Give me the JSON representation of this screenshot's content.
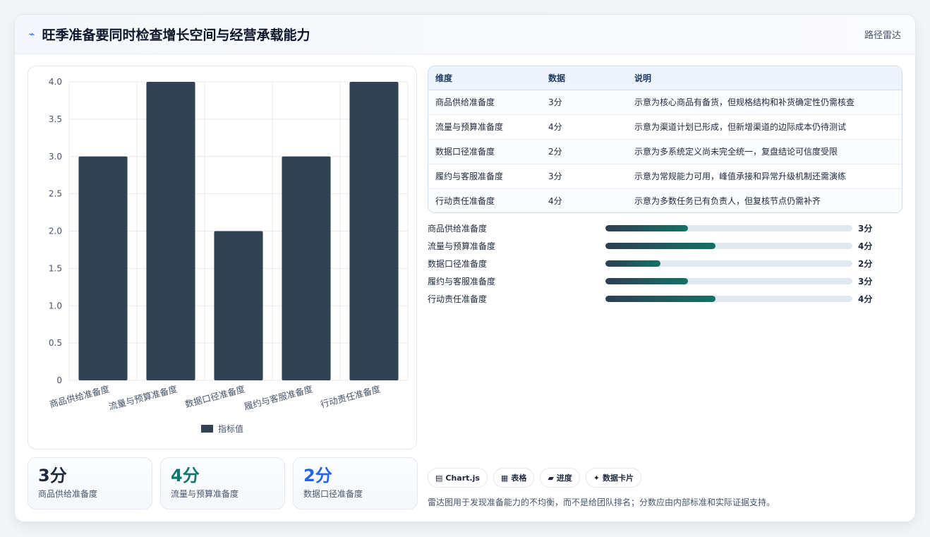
{
  "header": {
    "title": "旺季准备要同时检查增长空间与经营承载能力",
    "tag": "路径雷达"
  },
  "chart_data": {
    "type": "bar",
    "categories": [
      "商品供给准备度",
      "流量与预算准备度",
      "数据口径准备度",
      "履约与客服准备度",
      "行动责任准备度"
    ],
    "series": [
      {
        "name": "指标值",
        "values": [
          3,
          4,
          2,
          3,
          4
        ]
      }
    ],
    "ylim": [
      0,
      4
    ],
    "yticks": [
      "4.0",
      "3.5",
      "3.0",
      "2.5",
      "2.0",
      "1.5",
      "1.0",
      "0.5",
      "0"
    ],
    "legend_position": "bottom",
    "grid": true,
    "bar_color": "#334155"
  },
  "table": {
    "headers": [
      "维度",
      "数据",
      "说明"
    ],
    "rows": [
      {
        "dim": "商品供给准备度",
        "val": "3分",
        "desc": "示意为核心商品有备货，但规格结构和补货确定性仍需核查"
      },
      {
        "dim": "流量与预算准备度",
        "val": "4分",
        "desc": "示意为渠道计划已形成，但新增渠道的边际成本仍待测试"
      },
      {
        "dim": "数据口径准备度",
        "val": "2分",
        "desc": "示意为多系统定义尚未完全统一，复盘结论可信度受限"
      },
      {
        "dim": "履约与客服准备度",
        "val": "3分",
        "desc": "示意为常规能力可用，峰值承接和异常升级机制还需演练"
      },
      {
        "dim": "行动责任准备度",
        "val": "4分",
        "desc": "示意为多数任务已有负责人，但复核节点仍需补齐"
      }
    ]
  },
  "progress": [
    {
      "label": "商品供给准备度",
      "value": 3,
      "max": 9,
      "text": "3分"
    },
    {
      "label": "流量与预算准备度",
      "value": 4,
      "max": 9,
      "text": "4分"
    },
    {
      "label": "数据口径准备度",
      "value": 2,
      "max": 9,
      "text": "2分"
    },
    {
      "label": "履约与客服准备度",
      "value": 3,
      "max": 9,
      "text": "3分"
    },
    {
      "label": "行动责任准备度",
      "value": 4,
      "max": 9,
      "text": "4分"
    }
  ],
  "kpis": [
    {
      "value": "3分",
      "label": "商品供给准备度",
      "color": "#1e293b"
    },
    {
      "value": "4分",
      "label": "流量与预算准备度",
      "color": "#0f766e"
    },
    {
      "value": "2分",
      "label": "数据口径准备度",
      "color": "#2563eb"
    }
  ],
  "chips": [
    {
      "icon": "▤",
      "label": "Chart.js"
    },
    {
      "icon": "▦",
      "label": "表格"
    },
    {
      "icon": "▰",
      "label": "进度"
    },
    {
      "icon": "✦",
      "label": "数据卡片"
    }
  ],
  "note": "雷达图用于发现准备能力的不均衡，而不是给团队排名；分数应由内部标准和实际证据支持。"
}
